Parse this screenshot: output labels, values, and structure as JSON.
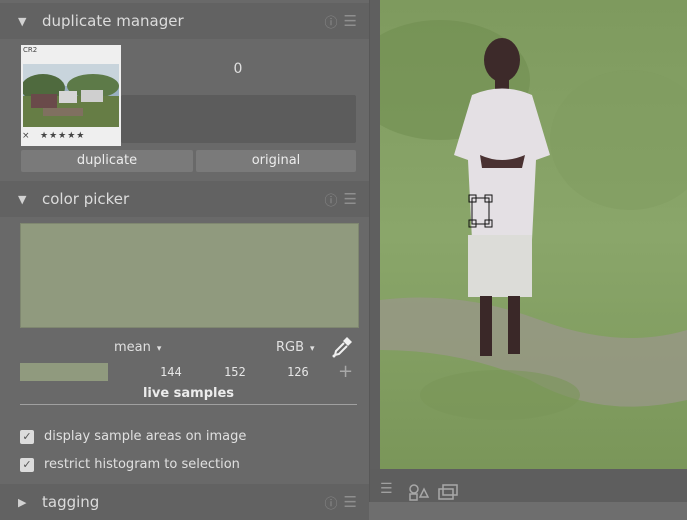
{
  "duplicate_manager": {
    "title": "duplicate manager",
    "thumbnail": {
      "format": "CR2",
      "reject": "×",
      "stars": "★★★★★"
    },
    "count": "0",
    "buttons": {
      "duplicate": "duplicate",
      "original": "original"
    }
  },
  "color_picker": {
    "title": "color picker",
    "swatch_color": "#909a7e",
    "statistic": "mean",
    "color_mode": "RGB",
    "values": {
      "r": "144",
      "g": "152",
      "b": "126"
    },
    "add_symbol": "+",
    "live_samples_title": "live samples",
    "options": {
      "display_sample_areas": "display sample areas on image",
      "restrict_histogram": "restrict histogram to selection"
    }
  },
  "tagging": {
    "title": "tagging"
  },
  "icons": {
    "expanded": "▼",
    "collapsed": "▶",
    "caret": "▾",
    "info": "ⓘ",
    "menu": "☰",
    "check": "✓"
  }
}
